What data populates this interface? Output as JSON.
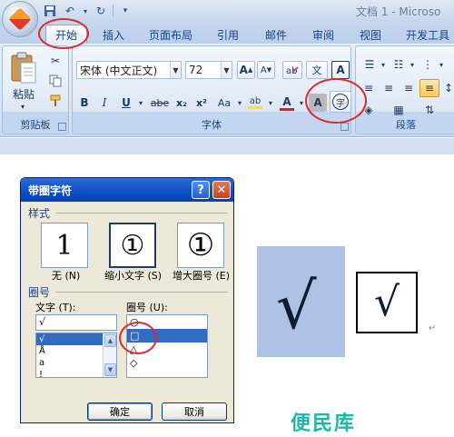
{
  "titlebar": {
    "doc_title": "文档 1 - Microso",
    "qat": [
      "save-icon",
      "undo-icon",
      "redo-icon",
      "customize-icon"
    ]
  },
  "tabs": [
    {
      "label": "开始",
      "active": true
    },
    {
      "label": "插入"
    },
    {
      "label": "页面布局"
    },
    {
      "label": "引用"
    },
    {
      "label": "邮件"
    },
    {
      "label": "审阅"
    },
    {
      "label": "视图"
    },
    {
      "label": "开发工具"
    }
  ],
  "ribbon": {
    "clipboard": {
      "label": "剪贴板",
      "paste_label": "粘贴"
    },
    "font": {
      "label": "字体",
      "font_name": "宋体 (中文正文)",
      "font_size": "72",
      "grow": "A",
      "shrink": "A",
      "char_border": "A",
      "wen": "文",
      "bold": "B",
      "italic": "I",
      "underline": "U",
      "strike": "abe",
      "sub": "x₂",
      "sup": "x²",
      "case": "Aa",
      "highlight": "ab",
      "font_color": "A",
      "shading": "A",
      "enclose_char": "字"
    },
    "paragraph": {
      "label": "段落"
    }
  },
  "dialog": {
    "title": "带圈字符",
    "help": "?",
    "close": "✕",
    "style_section": "样式",
    "styles": [
      {
        "preview": "1",
        "label": "无 (N)"
      },
      {
        "preview": "①",
        "label": "缩小文字 (S)"
      },
      {
        "preview": "①",
        "label": "增大圈号 (E)"
      }
    ],
    "enclosure_section": "圈号",
    "text_label": "文字 (T):",
    "text_value": "√",
    "text_list": [
      "√",
      "Å",
      "a",
      "!"
    ],
    "enclosure_label": "圈号 (U):",
    "enclosure_list": [
      "○",
      "□",
      "△",
      "◇"
    ],
    "ok": "确定",
    "cancel": "取消"
  },
  "document": {
    "check_shaded": "√",
    "check_framed": "√",
    "para_mark": "↵"
  },
  "watermark": "便民库",
  "colors": {
    "annotation": "#e0282d",
    "selection": "#316ac5",
    "shade": "#aec2e6"
  }
}
